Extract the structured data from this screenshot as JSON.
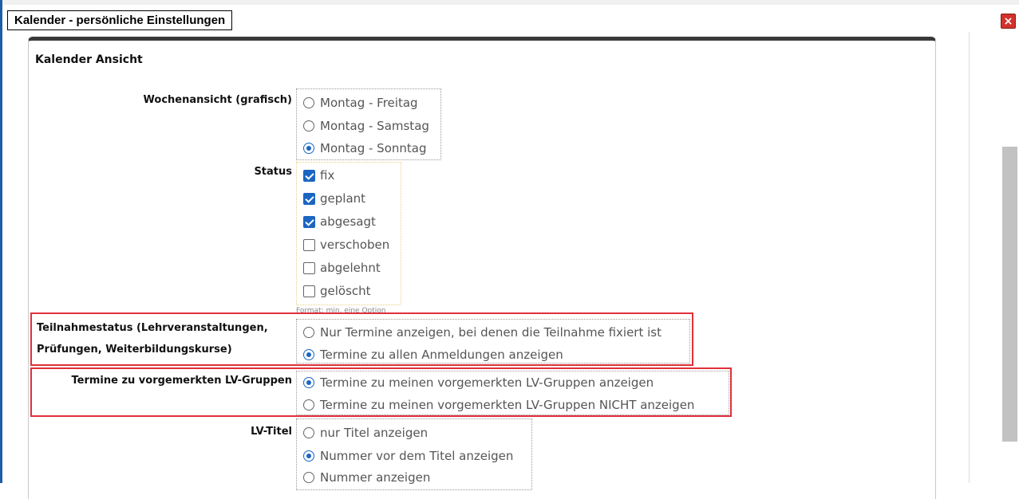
{
  "window": {
    "title": "Kalender - persönliche Einstellungen",
    "close_symbol": "×"
  },
  "section": {
    "title": "Kalender Ansicht"
  },
  "wochenansicht": {
    "label": "Wochenansicht (grafisch)",
    "options": [
      {
        "label": "Montag - Freitag",
        "selected": false
      },
      {
        "label": "Montag - Samstag",
        "selected": false
      },
      {
        "label": "Montag - Sonntag",
        "selected": true
      }
    ]
  },
  "status": {
    "label": "Status",
    "options": [
      {
        "label": "fix",
        "checked": true
      },
      {
        "label": "geplant",
        "checked": true
      },
      {
        "label": "abgesagt",
        "checked": true
      },
      {
        "label": "verschoben",
        "checked": false
      },
      {
        "label": "abgelehnt",
        "checked": false
      },
      {
        "label": "gelöscht",
        "checked": false
      }
    ],
    "hint": "Format: min. eine Option"
  },
  "teilnahmestatus": {
    "label_line1": "Teilnahmestatus (Lehrveranstaltungen,",
    "label_line2": "Prüfungen, Weiterbildungskurse)",
    "options": [
      {
        "label": "Nur Termine anzeigen, bei denen die Teilnahme fixiert ist",
        "selected": false
      },
      {
        "label": "Termine zu allen Anmeldungen anzeigen",
        "selected": true
      }
    ]
  },
  "vorgemerkt": {
    "label": "Termine zu vorgemerkten LV-Gruppen",
    "options": [
      {
        "label": "Termine zu meinen vorgemerkten LV-Gruppen anzeigen",
        "selected": true
      },
      {
        "label": "Termine zu meinen vorgemerkten LV-Gruppen NICHT anzeigen",
        "selected": false
      }
    ]
  },
  "lvtitel": {
    "label": "LV-Titel",
    "options": [
      {
        "label": "nur Titel anzeigen",
        "selected": false
      },
      {
        "label": "Nummer vor dem Titel anzeigen",
        "selected": true
      },
      {
        "label": "Nummer anzeigen",
        "selected": false
      }
    ]
  },
  "colors": {
    "accent": "#1a66c2",
    "highlight": "#e0303a",
    "close": "#d1322b"
  }
}
